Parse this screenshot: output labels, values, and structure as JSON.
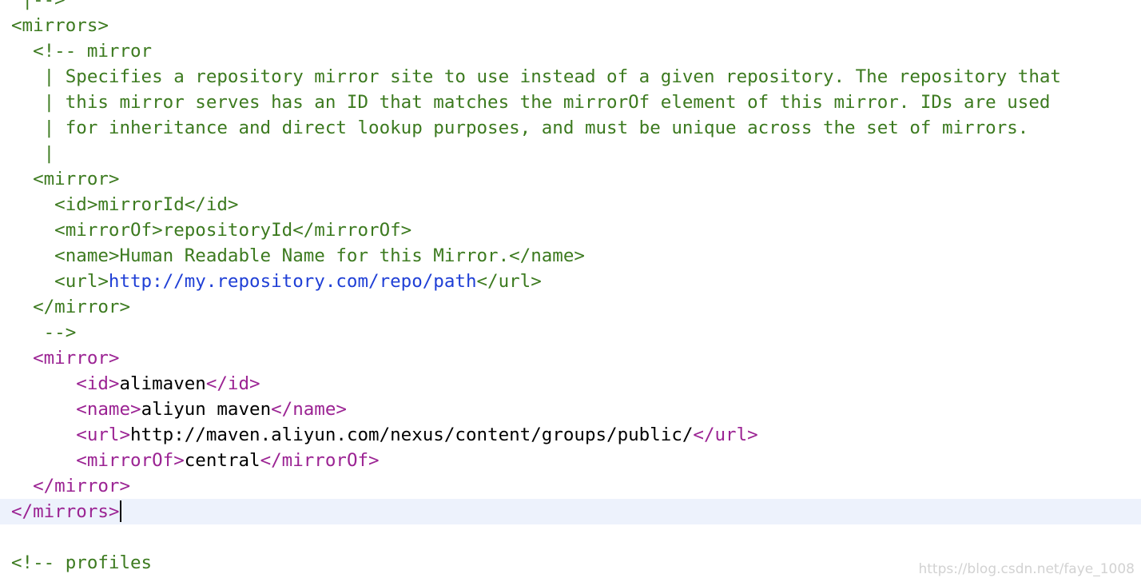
{
  "editor": {
    "language": "xml",
    "colors": {
      "comment": "#3c7a1f",
      "tag": "#9b2393",
      "text": "#000000",
      "link": "#1f3fd6",
      "current_line_bg": "#edf2fc"
    },
    "current_line_index": 20,
    "lines": [
      [
        {
          "t": " |-->",
          "c": "comment"
        }
      ],
      [
        {
          "t": "<mirrors>",
          "c": "comment"
        }
      ],
      [
        {
          "t": "  <!-- mirror",
          "c": "comment"
        }
      ],
      [
        {
          "t": "   | Specifies a repository mirror site to use instead of a given repository. The repository that",
          "c": "comment"
        }
      ],
      [
        {
          "t": "   | this mirror serves has an ID that matches the mirrorOf element of this mirror. IDs are used",
          "c": "comment"
        }
      ],
      [
        {
          "t": "   | for inheritance and direct lookup purposes, and must be unique across the set of mirrors.",
          "c": "comment"
        }
      ],
      [
        {
          "t": "   |",
          "c": "comment"
        }
      ],
      [
        {
          "t": "  <mirror>",
          "c": "comment"
        }
      ],
      [
        {
          "t": "    <id>mirrorId</id>",
          "c": "comment"
        }
      ],
      [
        {
          "t": "    <mirrorOf>repositoryId</mirrorOf>",
          "c": "comment"
        }
      ],
      [
        {
          "t": "    <name>Human Readable Name for this Mirror.</name>",
          "c": "comment"
        }
      ],
      [
        {
          "t": "    <url>",
          "c": "comment"
        },
        {
          "t": "http://my.repository.com/repo/path",
          "c": "link"
        },
        {
          "t": "</url>",
          "c": "comment"
        }
      ],
      [
        {
          "t": "  </mirror>",
          "c": "comment"
        }
      ],
      [
        {
          "t": "   -->",
          "c": "comment"
        }
      ],
      [
        {
          "t": "  <mirror>",
          "c": "tag"
        }
      ],
      [
        {
          "t": "      <id>",
          "c": "tag"
        },
        {
          "t": "alimaven",
          "c": "text"
        },
        {
          "t": "</id>",
          "c": "tag"
        }
      ],
      [
        {
          "t": "      <name>",
          "c": "tag"
        },
        {
          "t": "aliyun maven",
          "c": "text"
        },
        {
          "t": "</name>",
          "c": "tag"
        }
      ],
      [
        {
          "t": "      <url>",
          "c": "tag"
        },
        {
          "t": "http://maven.aliyun.com/nexus/content/groups/public/",
          "c": "text"
        },
        {
          "t": "</url>",
          "c": "tag"
        }
      ],
      [
        {
          "t": "      <mirrorOf>",
          "c": "tag"
        },
        {
          "t": "central",
          "c": "text"
        },
        {
          "t": "</mirrorOf>",
          "c": "tag"
        }
      ],
      [
        {
          "t": "  </mirror>",
          "c": "tag"
        }
      ],
      [
        {
          "t": "</mirrors>",
          "c": "tag"
        }
      ],
      [
        {
          "t": "",
          "c": "text"
        }
      ],
      [
        {
          "t": "<!-- profiles",
          "c": "comment"
        }
      ]
    ]
  },
  "watermark": "https://blog.csdn.net/faye_1008"
}
